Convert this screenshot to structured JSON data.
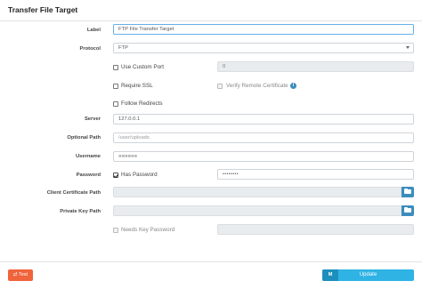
{
  "title": "Transfer File Target",
  "fields": {
    "label": {
      "label": "Label",
      "value": "FTP File Transfer Target"
    },
    "protocol": {
      "label": "Protocol",
      "value": "FTP"
    },
    "use_custom_port": {
      "label": "Use Custom Port",
      "checked": false,
      "port_value": "0"
    },
    "require_ssl": {
      "label": "Require SSL",
      "checked": false
    },
    "verify_cert": {
      "label": "Verify Remote Certificate",
      "checked": false,
      "info_glyph": "i"
    },
    "follow_redirects": {
      "label": "Follow Redirects",
      "checked": false
    },
    "server": {
      "label": "Server",
      "value": "127.0.0.1"
    },
    "optional_path": {
      "label": "Optional Path",
      "placeholder": "/user/uploads"
    },
    "username": {
      "label": "Username",
      "value": "■■■■■■"
    },
    "password": {
      "label": "Password",
      "has_password_label": "Has Password",
      "checked": true,
      "value": "••••••••"
    },
    "client_cert_path": {
      "label": "Client Certificate Path",
      "value": ""
    },
    "private_key_path": {
      "label": "Private Key Path",
      "value": ""
    },
    "needs_key_password": {
      "label": "Needs Key Password",
      "checked": false,
      "value": ""
    }
  },
  "buttons": {
    "test": {
      "label": "Test",
      "icon": "exchange-icon",
      "glyph": "⇄"
    },
    "update": {
      "label": "Update",
      "icon": "save-icon",
      "glyph": "M"
    }
  },
  "colors": {
    "accent": "#3c8dbc",
    "test_button": "#f0633b",
    "update_button": "#2fb3e4"
  }
}
